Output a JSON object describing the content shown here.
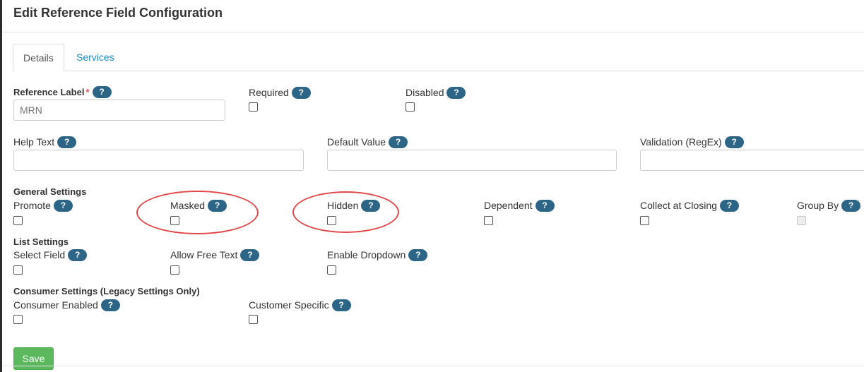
{
  "page": {
    "title": "Edit Reference Field Configuration"
  },
  "tabs": [
    {
      "label": "Details",
      "active": true
    },
    {
      "label": "Services",
      "active": false
    }
  ],
  "help_icon_text": "?",
  "required_marker": "*",
  "fields": {
    "reference_label": {
      "label": "Reference Label",
      "value": "MRN"
    },
    "required": {
      "label": "Required",
      "checked": false
    },
    "disabled": {
      "label": "Disabled",
      "checked": false
    },
    "help_text": {
      "label": "Help Text",
      "value": ""
    },
    "default_value": {
      "label": "Default Value",
      "value": ""
    },
    "validation": {
      "label": "Validation (RegEx)",
      "value": ""
    }
  },
  "general_settings": {
    "title": "General Settings",
    "promote": "Promote",
    "masked": "Masked",
    "hidden": "Hidden",
    "dependent": "Dependent",
    "collect_at_closing": "Collect at Closing",
    "group_by": "Group By"
  },
  "list_settings": {
    "title": "List Settings",
    "select_field": "Select Field",
    "allow_free_text": "Allow Free Text",
    "enable_dropdown": "Enable Dropdown"
  },
  "consumer_settings": {
    "title": "Consumer Settings (Legacy Settings Only)",
    "consumer_enabled": "Consumer Enabled",
    "customer_specific": "Customer Specific"
  },
  "actions": {
    "save_label": "Save"
  },
  "colors": {
    "help_badge": "#2d6587",
    "tab_link": "#1b8ac6",
    "save_button": "#5cb85c",
    "annotation_ellipse": "#e0484a",
    "required_star": "#d9534f"
  }
}
